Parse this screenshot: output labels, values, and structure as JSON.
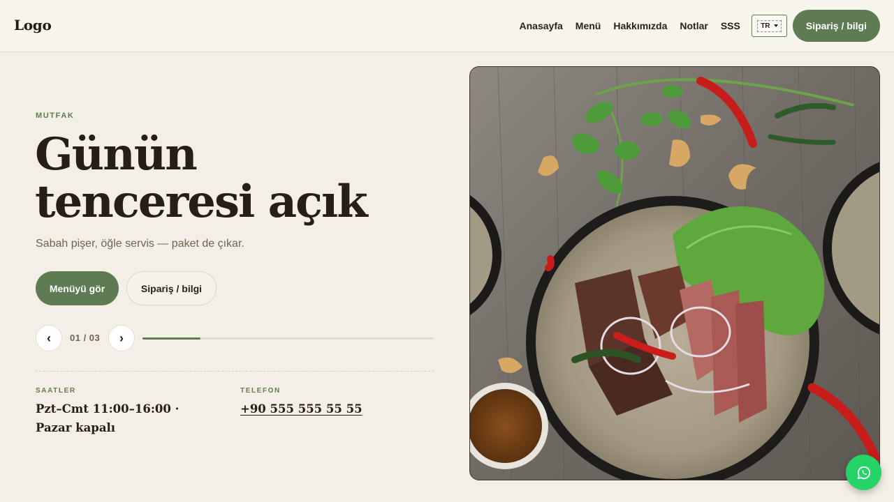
{
  "header": {
    "logo": "Logo",
    "nav": [
      "Anasayfa",
      "Menü",
      "Hakkımızda",
      "Notlar",
      "SSS"
    ],
    "lang": "TR",
    "cta": "Sipariş / bilgi"
  },
  "hero": {
    "eyebrow": "MUTFAK",
    "title_line1": "Günün",
    "title_line2": "tenceresi açık",
    "subtitle": "Sabah pişer, öğle servis — paket de çıkar.",
    "primary_button": "Menüyü gör",
    "secondary_button": "Sipariş / bilgi",
    "slider": {
      "prev": "‹",
      "next": "›",
      "counter": "01 / 03",
      "progress": 0.2
    }
  },
  "info": {
    "hours_label": "SAATLER",
    "hours_value": "Pzt–Cmt 11:00–16:00 · Pazar kapalı",
    "phone_label": "TELEFON",
    "phone_value": "+90 555 555 55 55"
  },
  "colors": {
    "accent": "#5e7b53",
    "background": "#f4efe6",
    "whatsapp": "#25d366"
  },
  "icons": {
    "whatsapp": "whatsapp-icon"
  }
}
